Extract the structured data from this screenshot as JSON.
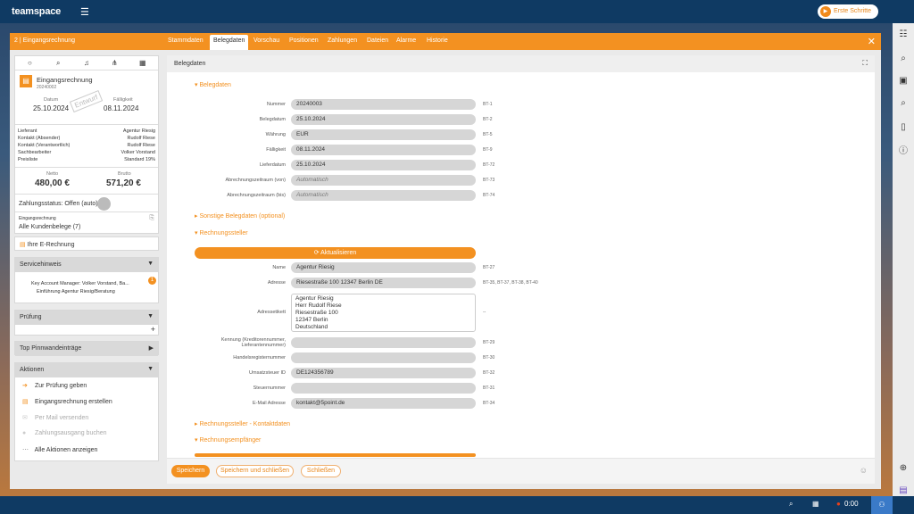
{
  "topbar": {
    "logo": "teamspace",
    "menu_icon": "menu-icon",
    "erste_label": "Erste Schritte"
  },
  "tabs": {
    "crumb": "2 | Eingangsrechnung",
    "items": [
      "Stammdaten",
      "Belegdaten",
      "Vorschau",
      "Positionen",
      "Zahlungen",
      "Dateien",
      "Alarme",
      "Historie"
    ],
    "close": "✕"
  },
  "summary": {
    "title": "Eingangsrechnung",
    "number": "20240002",
    "datum_label": "Datum",
    "datum": "25.10.2024",
    "faellig_label": "Fälligkeit",
    "faellig": "08.11.2024",
    "stamp": "Entwurf",
    "rows": [
      [
        "Lieferant",
        "Agentur Riesig"
      ],
      [
        "Kontakt (Absender)",
        "Rudolf Riese"
      ],
      [
        "Kontakt (Verantwortlich)",
        "Rudolf Riese"
      ],
      [
        "Sachbearbeiter",
        "Volker Vorstand"
      ],
      [
        "Preisliste",
        "Standard 19%"
      ]
    ],
    "netto_label": "Netto",
    "netto": "480,00 €",
    "brutto_label": "Brutto",
    "brutto": "571,20 €",
    "status": "Zahlungsstatus: Offen (auto)",
    "cat_label": "Eingangsrechnung",
    "cat_value": "Alle Kundenbelege (7)"
  },
  "erech": "Ihre E-Rechnung",
  "service": {
    "title": "Servicehinweis",
    "kam": "Key Account Manager:",
    "kam_v1": "Volker Vorstand,",
    "kam_v2": "Ba...",
    "link": "Einführung Agentur Riesig/Beratung",
    "badge": "1"
  },
  "pruefung": "Prüfung",
  "pinnwand": "Top Pinnwandeinträge",
  "aktionen": {
    "title": "Aktionen",
    "items": [
      "Zur Prüfung geben",
      "Eingangsrechnung erstellen",
      "Per Mail versenden",
      "Zahlungsausgang buchen",
      "Alle Aktionen anzeigen"
    ]
  },
  "main": {
    "header": "Belegdaten",
    "sec_beleg": "Belegdaten",
    "beleg_fields": [
      {
        "label": "Nummer",
        "value": "20240003",
        "bt": "BT-1"
      },
      {
        "label": "Belegdatum",
        "value": "25.10.2024",
        "bt": "BT-2"
      },
      {
        "label": "Währung",
        "value": "EUR",
        "bt": "BT-5"
      },
      {
        "label": "Fälligkeit",
        "value": "08.11.2024",
        "bt": "BT-9"
      },
      {
        "label": "Lieferdatum",
        "value": "25.10.2024",
        "bt": "BT-72"
      },
      {
        "label": "Abrechnungszeitraum (von)",
        "value": "Automatisch",
        "bt": "BT-73"
      },
      {
        "label": "Abrechnungszeitraum (bis)",
        "value": "Automatisch",
        "bt": "BT-74"
      }
    ],
    "sec_sonstige": "Sonstige Belegdaten (optional)",
    "sec_steller": "Rechnungssteller",
    "aktualisieren": "Aktualisieren",
    "steller_name_label": "Name",
    "steller_name": "Agentur Riesig",
    "steller_name_bt": "BT-27",
    "steller_adr_label": "Adresse",
    "steller_adr": "Riesestraße 100 12347 Berlin DE",
    "steller_adr_bt": "BT-35, BT-37, BT-38, BT-40",
    "etikett_label": "Adressetikett",
    "etikett_lines": [
      "Agentur Riesig",
      "Herr Rudolf Riese",
      "Riesestraße 100",
      "12347 Berlin",
      "Deutschland"
    ],
    "etikett_bt": "--",
    "kennung_label": "Kennung (Kreditorennummer, Lieferantennummer)",
    "kennung_bt": "BT-29",
    "hreg_label": "Handelsregisternummer",
    "hreg_bt": "BT-30",
    "ust_label": "Umsatzsteuer ID",
    "ust": "DE124356789",
    "ust_bt": "BT-32",
    "steuer_label": "Steuernummer",
    "steuer_bt": "BT-31",
    "mail_label": "E-Mail Adresse",
    "mail": "kontakt@5point.de",
    "mail_bt": "BT-34",
    "sec_kontakt": "Rechnungssteller - Kontaktdaten",
    "sec_empf": "Rechnungsempfänger",
    "btn_save": "Speichern",
    "btn_save_close": "Speichern und schließen",
    "btn_close": "Schließen"
  },
  "bottom": {
    "time": "0:00"
  }
}
